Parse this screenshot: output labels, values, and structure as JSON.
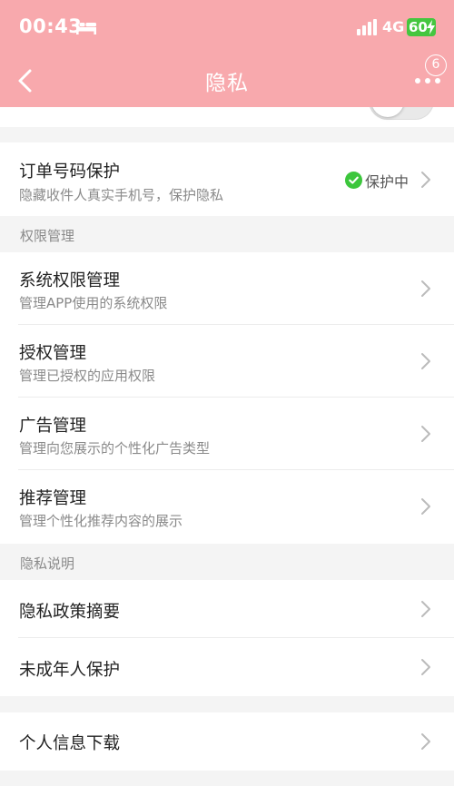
{
  "status_bar": {
    "time": "00:43",
    "network": "4G",
    "battery": "60"
  },
  "header": {
    "title": "隐私",
    "badge_count": "6"
  },
  "order_protect": {
    "title": "订单号码保护",
    "subtitle": "隐藏收件人真实手机号，保护隐私",
    "status": "保护中"
  },
  "sections": {
    "permissions": "权限管理",
    "privacy_info": "隐私说明"
  },
  "permissions": [
    {
      "title": "系统权限管理",
      "subtitle": "管理APP使用的系统权限"
    },
    {
      "title": "授权管理",
      "subtitle": "管理已授权的应用权限"
    },
    {
      "title": "广告管理",
      "subtitle": "管理向您展示的个性化广告类型"
    },
    {
      "title": "推荐管理",
      "subtitle": "管理个性化推荐内容的展示"
    }
  ],
  "privacy_info": [
    {
      "title": "隐私政策摘要"
    },
    {
      "title": "未成年人保护"
    }
  ],
  "download": {
    "title": "个人信息下载"
  },
  "colors": {
    "header": "#f8a9ad",
    "check": "#3cc63c",
    "battery": "#45c63f"
  }
}
